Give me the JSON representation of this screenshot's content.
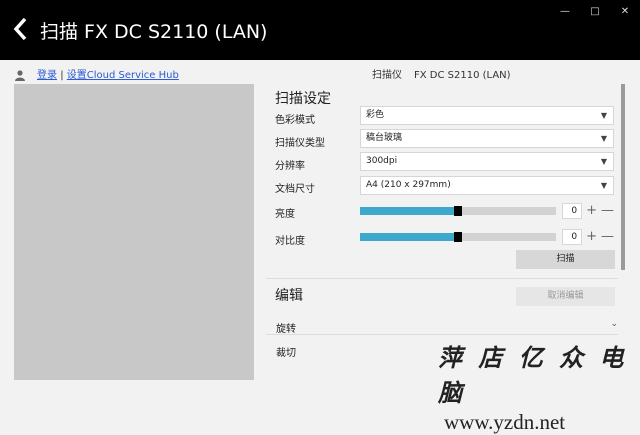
{
  "window": {
    "title": "扫描 FX DC S2110 (LAN)",
    "controls": [
      "—",
      "□",
      "✕"
    ]
  },
  "toolbar": {
    "login_link": "登录",
    "separator": "|",
    "cloud_link": "设置Cloud Service Hub",
    "scanner_label": "扫描仪",
    "scanner_value": "FX DC S2110 (LAN)"
  },
  "scan_settings": {
    "title": "扫描设定",
    "color_mode": {
      "label": "色彩模式",
      "value": "彩色"
    },
    "scanner_type": {
      "label": "扫描仪类型",
      "value": "稿台玻璃"
    },
    "resolution": {
      "label": "分辨率",
      "value": "300dpi"
    },
    "doc_size": {
      "label": "文档尺寸",
      "value": "A4 (210 x 297mm)"
    },
    "brightness": {
      "label": "亮度",
      "value": "0",
      "level": 0.5
    },
    "contrast": {
      "label": "对比度",
      "value": "0",
      "level": 0.5
    },
    "scan_button": "扫描"
  },
  "edit": {
    "title": "编辑",
    "cancel_button": "取消编辑",
    "rotate": "旋转",
    "crop": "裁切"
  },
  "watermark": {
    "line1": "萍 店 亿 众 电 脑",
    "line2": "www.yzdn.net"
  },
  "colors": {
    "accent": "#3ba9cc",
    "titlebar": "#000000"
  }
}
